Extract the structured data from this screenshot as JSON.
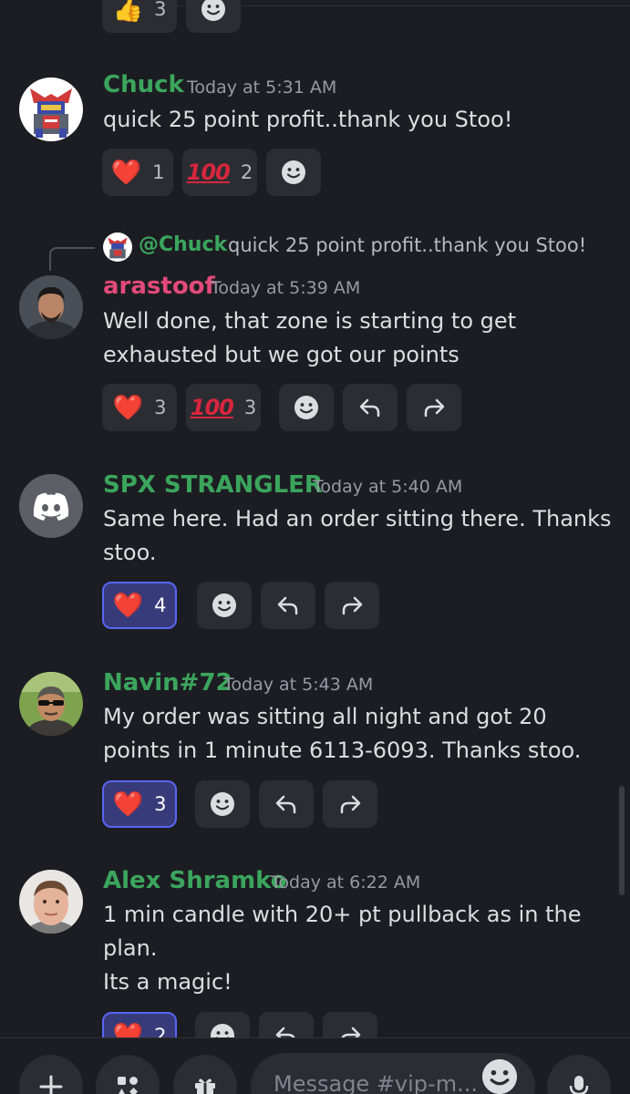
{
  "messages": [
    {
      "id": "chuck",
      "author": "Chuck",
      "author_color": "#3ba55d",
      "timestamp": "Today at 5:31 AM",
      "lines": [
        "quick 25 point profit..thank you Stoo!"
      ],
      "reactions": [
        {
          "emoji": "heart",
          "count": "1",
          "mine": false
        },
        {
          "emoji": "hundred-points",
          "count": "2",
          "mine": false
        }
      ]
    },
    {
      "id": "arastoof",
      "author": "arastoof",
      "author_color": "#e24a7a",
      "timestamp": "Today at 5:39 AM",
      "reply": {
        "mention": "@Chuck",
        "text": "quick 25 point profit..thank you Stoo!"
      },
      "lines": [
        "Well done, that zone is starting to get",
        "exhausted but we got our points"
      ],
      "reactions": [
        {
          "emoji": "heart",
          "count": "3",
          "mine": false
        },
        {
          "emoji": "hundred-points",
          "count": "3",
          "mine": false
        }
      ]
    },
    {
      "id": "spx",
      "author": "SPX STRANGLER",
      "author_color": "#3ba55d",
      "timestamp": "Today at 5:40 AM",
      "lines": [
        "Same here. Had an order sitting there. Thanks",
        "stoo."
      ],
      "reactions": [
        {
          "emoji": "heart",
          "count": "4",
          "mine": true
        }
      ]
    },
    {
      "id": "navin",
      "author": "Navin#72",
      "author_color": "#3ba55d",
      "timestamp": "Today at 5:43 AM",
      "lines": [
        "My order was sitting all night and got 20",
        "points in 1 minute 6113-6093. Thanks stoo."
      ],
      "reactions": [
        {
          "emoji": "heart",
          "count": "3",
          "mine": true
        }
      ]
    },
    {
      "id": "alex",
      "author": "Alex Shramko",
      "author_color": "#3ba55d",
      "timestamp": "Today at 6:22 AM",
      "lines": [
        "1 min candle with 20+ pt pullback as in the",
        "plan.",
        "Its a magic!"
      ],
      "reactions": [
        {
          "emoji": "heart",
          "count": "2",
          "mine": true
        }
      ]
    }
  ],
  "top_partial_reaction": {
    "emoji": "thumbs-up",
    "count": "3"
  },
  "composer": {
    "placeholder": "Message #vip-m..."
  },
  "icons": {
    "add_reaction": "smiley-add-reaction-icon",
    "reply": "reply-arrow-icon",
    "forward": "forward-arrow-icon",
    "plus": "plus-icon",
    "apps": "apps-icon",
    "gift": "gift-icon",
    "emoji": "emoji-icon",
    "mic": "microphone-icon"
  }
}
